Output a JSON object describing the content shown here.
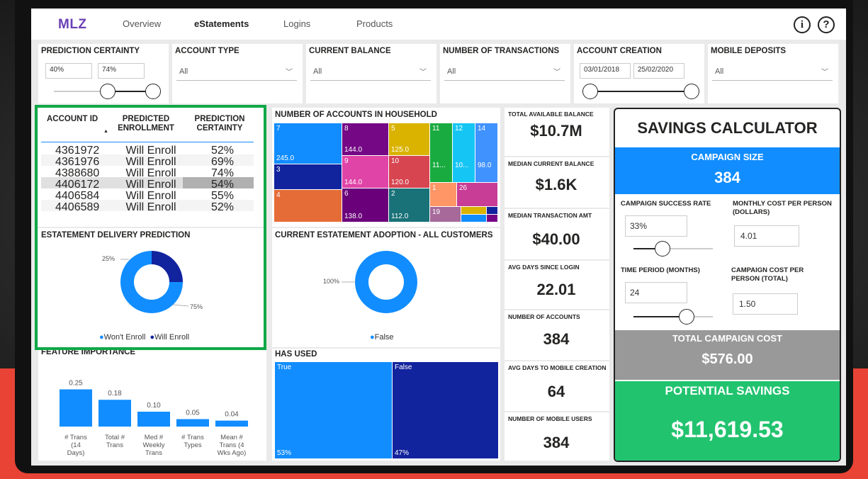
{
  "nav": {
    "logo": "MLZ",
    "tabs": [
      "Overview",
      "eStatements",
      "Logins",
      "Products"
    ],
    "info_icon": "i",
    "help_icon": "?"
  },
  "slicers": {
    "prediction_certainty": {
      "title": "PREDICTION CERTAINTY",
      "min": "40%",
      "max": "74%"
    },
    "account_type": {
      "title": "ACCOUNT TYPE",
      "value": "All"
    },
    "current_balance": {
      "title": "CURRENT BALANCE",
      "value": "All"
    },
    "num_transactions": {
      "title": "NUMBER OF TRANSACTIONS",
      "value": "All"
    },
    "account_creation": {
      "title": "ACCOUNT CREATION",
      "start": "03/01/2018",
      "end": "25/02/2020"
    },
    "mobile_deposits": {
      "title": "MOBILE DEPOSITS",
      "value": "All"
    }
  },
  "table": {
    "headers": [
      "ACCOUNT ID",
      "PREDICTED ENROLLMENT",
      "PREDICTION CERTAINTY"
    ],
    "rows": [
      [
        "4361972",
        "Will Enroll",
        "52%"
      ],
      [
        "4361976",
        "Will Enroll",
        "69%"
      ],
      [
        "4388680",
        "Will Enroll",
        "74%"
      ],
      [
        "4406172",
        "Will Enroll",
        "54%"
      ],
      [
        "4406584",
        "Will Enroll",
        "55%"
      ],
      [
        "4406589",
        "Will Enroll",
        "52%"
      ]
    ]
  },
  "delivery": {
    "title": "ESTATEMENT DELIVERY PREDICTION",
    "label_small": "25%",
    "label_large": "75%",
    "legend": [
      "Won't Enroll",
      "Will Enroll"
    ],
    "colors": [
      "#118dff",
      "#12239e"
    ]
  },
  "feature": {
    "title": "FEATURE IMPORTANCE"
  },
  "household": {
    "title": "NUMBER OF ACCOUNTS IN HOUSEHOLD"
  },
  "adoption": {
    "title": "CURRENT ESTATEMENT ADOPTION - ALL CUSTOMERS",
    "label": "100%",
    "legend": "False"
  },
  "has_used": {
    "title": "HAS USED",
    "true_label": "True",
    "false_label": "False",
    "true_pct": "53%",
    "false_pct": "47%"
  },
  "kpis": [
    {
      "title": "TOTAL AVAILABLE BALANCE",
      "value": "$10.7M"
    },
    {
      "title": "MEDIAN CURRENT BALANCE",
      "value": "$1.6K"
    },
    {
      "title": "MEDIAN TRANSACTION AMT",
      "value": "$40.00"
    },
    {
      "title": "AVG DAYS SINCE LOGIN",
      "value": "22.01"
    },
    {
      "title": "NUMBER OF ACCOUNTS",
      "value": "384"
    },
    {
      "title": "AVG DAYS TO MOBILE CREATION",
      "value": "64"
    },
    {
      "title": "NUMBER OF MOBILE USERS",
      "value": "384"
    }
  ],
  "calculator": {
    "title": "SAVINGS CALCULATOR",
    "campaign_size_label": "CAMPAIGN SIZE",
    "campaign_size": "384",
    "success_rate_label": "CAMPAIGN SUCCESS RATE",
    "success_rate": "33%",
    "monthly_cost_label": "MONTHLY COST PER PERSON (DOLLARS)",
    "monthly_cost": "4.01",
    "time_period_label": "TIME PERIOD (MONTHS)",
    "time_period": "24",
    "cost_per_person_label": "CAMPAIGN COST PER PERSON (TOTAL)",
    "cost_per_person": "1.50",
    "total_cost_label": "TOTAL CAMPAIGN COST",
    "total_cost": "$576.00",
    "savings_label": "POTENTIAL SAVINGS",
    "savings": "$11,619.53"
  },
  "chart_data": [
    {
      "type": "bar",
      "title": "FEATURE IMPORTANCE",
      "categories": [
        "# Trans (14 Days)",
        "Total # Trans",
        "Med # Weekly Trans",
        "# Trans Types",
        "Mean # Trans (4 Wks Ago)"
      ],
      "values": [
        0.25,
        0.18,
        0.1,
        0.05,
        0.04
      ],
      "value_labels": [
        "0.25",
        "0.18",
        "0.10",
        "0.05",
        "0.04"
      ]
    },
    {
      "type": "pie",
      "title": "ESTATEMENT DELIVERY PREDICTION",
      "categories": [
        "Won't Enroll",
        "Will Enroll"
      ],
      "values": [
        75,
        25
      ]
    },
    {
      "type": "pie",
      "title": "CURRENT ESTATEMENT ADOPTION - ALL CUSTOMERS",
      "categories": [
        "False"
      ],
      "values": [
        100
      ]
    },
    {
      "type": "treemap",
      "title": "NUMBER OF ACCOUNTS IN HOUSEHOLD",
      "categories": [
        "7",
        "8",
        "5",
        "11",
        "12",
        "14",
        "3",
        "9",
        "10",
        "1",
        "26",
        "4",
        "6",
        "2",
        "19"
      ],
      "value_labels": [
        "245.0",
        "144.0",
        "125.0",
        "11...",
        "10...",
        "98.0",
        "",
        "144.0",
        "120.0",
        "",
        "",
        "",
        "138.0",
        "112.0",
        ""
      ]
    },
    {
      "type": "treemap",
      "title": "HAS USED",
      "categories": [
        "True",
        "False"
      ],
      "values": [
        53,
        47
      ]
    }
  ]
}
